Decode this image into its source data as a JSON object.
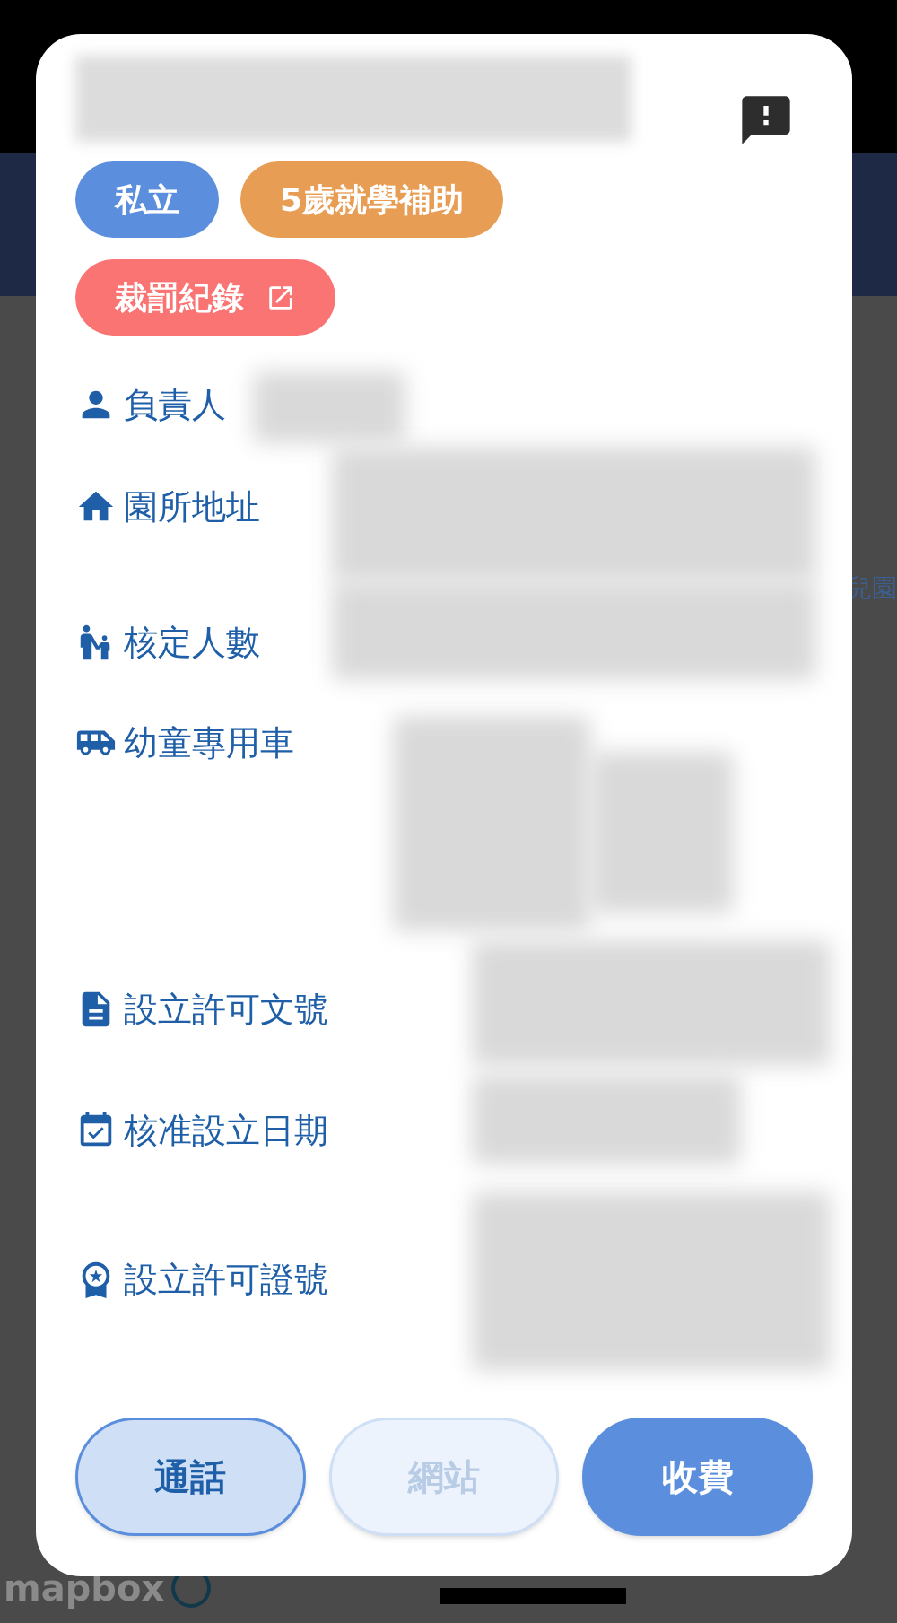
{
  "map": {
    "place_label": "兒園",
    "logo": "mapbox"
  },
  "dialog": {
    "tags": [
      {
        "label": "私立",
        "color": "#5b8fdd",
        "link": false
      },
      {
        "label": "5歲就學補助",
        "color": "#e89d55",
        "link": false
      },
      {
        "label": "裁罰紀錄",
        "color": "#fb7474",
        "link": true
      }
    ],
    "fields": [
      {
        "kind": "person",
        "label": "負責人"
      },
      {
        "kind": "address",
        "label": "園所地址"
      },
      {
        "kind": "capacity",
        "label": "核定人數"
      },
      {
        "kind": "bus",
        "label": "幼童專用車"
      },
      {
        "kind": "document",
        "label": "設立許可文號"
      },
      {
        "kind": "date",
        "label": "核准設立日期"
      },
      {
        "kind": "license",
        "label": "設立許可證號"
      }
    ],
    "buttons": [
      {
        "label": "通話",
        "kind": "outlined",
        "disabled": false
      },
      {
        "label": "網站",
        "kind": "outlined",
        "disabled": true
      },
      {
        "label": "收費",
        "kind": "filled",
        "disabled": false
      }
    ]
  }
}
